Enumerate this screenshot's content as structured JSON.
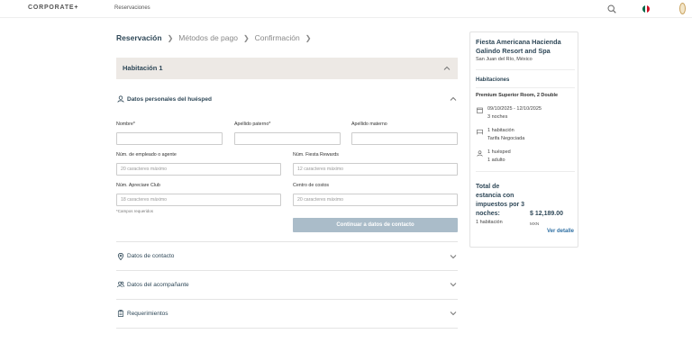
{
  "header": {
    "logo": "CORPORATE+",
    "nav_link": "Reservaciones",
    "icons": [
      "search-icon",
      "flag-mexico-icon",
      "user-avatar"
    ]
  },
  "steps": {
    "items": [
      "Reservación",
      "Métodos de pago",
      "Confirmación"
    ],
    "active_index": 0
  },
  "room": {
    "title": "Habitación 1"
  },
  "guest_section": {
    "title": "Datos personales del huésped",
    "fields": {
      "nombre_label": "Nombre*",
      "apellido_paterno_label": "Apellido paterno*",
      "apellido_materno_label": "Apellido materno",
      "empleado_label": "Núm. de empleado o agente",
      "empleado_placeholder": "20 caracteres máximo",
      "fiesta_label": "Núm. Fiesta Rewards",
      "fiesta_placeholder": "12 caracteres máximo",
      "apreciare_label": "Núm. Apreciare Club",
      "apreciare_placeholder": "18 caracteres máximo",
      "costos_label": "Centro de costos",
      "costos_placeholder": "20 caracteres máximo"
    },
    "required_note": "*Campos requeridos",
    "continue_button": "Continuar a datos de contacto"
  },
  "collapsed_sections": {
    "contacto": "Datos de contacto",
    "acompanante": "Datos del acompañante",
    "requerimientos": "Requerimientos"
  },
  "summary": {
    "hotel_name": "Fiesta Americana Hacienda Galindo Resort and Spa",
    "location": "San Juan del Río, México",
    "rooms_heading": "Habitaciones",
    "room_type": "Premium Superior Room, 2 Double",
    "dates": "09/10/2025 - 12/10/2025",
    "nights": "3 noches",
    "room_count": "1 habitación",
    "rate": "Tarifa Negociada",
    "guests": "1 huésped",
    "adults": "1 adulto",
    "total_label": "Total de estancia con impuestos por 3 noches:",
    "total_rooms": "1 habitación",
    "price": "$ 12,189.00",
    "currency": "MXN",
    "details_link": "Ver detalle"
  },
  "colors": {
    "primary": "#2f4858",
    "link": "#2e6fa3",
    "button_disabled": "#aabcc9",
    "room_header_bg": "#ede9e5"
  }
}
